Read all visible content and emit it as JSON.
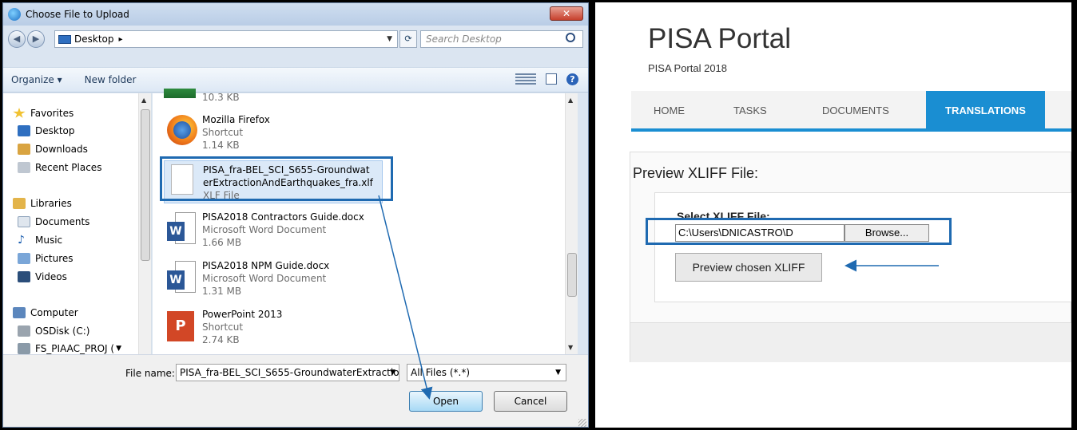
{
  "dialog": {
    "title": "Choose File to Upload",
    "close": "✕",
    "address": "Desktop",
    "search_placeholder": "Search Desktop",
    "toolbar": {
      "organize": "Organize ▾",
      "new_folder": "New folder"
    },
    "nav": {
      "favorites": "Favorites",
      "desktop": "Desktop",
      "downloads": "Downloads",
      "recent": "Recent Places",
      "libraries": "Libraries",
      "documents": "Documents",
      "music": "Music",
      "pictures": "Pictures",
      "videos": "Videos",
      "computer": "Computer",
      "osdisk": "OSDisk (C:)",
      "fs": "FS_PIAAC_PROJ ("
    },
    "files": [
      {
        "name": "",
        "type": "",
        "size": "10.3 KB"
      },
      {
        "name": "Mozilla Firefox",
        "type": "Shortcut",
        "size": "1.14 KB"
      },
      {
        "name": "PISA_fra-BEL_SCI_S655-Groundwat",
        "name2": "erExtractionAndEarthquakes_fra.xlf",
        "type": "XLF File"
      },
      {
        "name": "PISA2018 Contractors Guide.docx",
        "type": "Microsoft Word Document",
        "size": "1.66 MB"
      },
      {
        "name": "PISA2018 NPM Guide.docx",
        "type": "Microsoft Word Document",
        "size": "1.31 MB"
      },
      {
        "name": "PowerPoint 2013",
        "type": "Shortcut",
        "size": "2.74 KB"
      }
    ],
    "file_name_label": "File name:",
    "file_name_value": "PISA_fra-BEL_SCI_S655-GroundwaterExtractio",
    "filter": "All Files (*.*)",
    "open": "Open",
    "cancel": "Cancel"
  },
  "portal": {
    "title": "PISA Portal",
    "subtitle": "PISA Portal 2018",
    "nav": [
      "HOME",
      "TASKS",
      "DOCUMENTS",
      "TRANSLATIONS"
    ],
    "preview_title": "Preview XLIFF File:",
    "select_label": "Select XLIFF File:",
    "file_value": "C:\\Users\\DNICASTRO\\D",
    "browse": "Browse...",
    "preview_btn": "Preview chosen XLIFF"
  }
}
